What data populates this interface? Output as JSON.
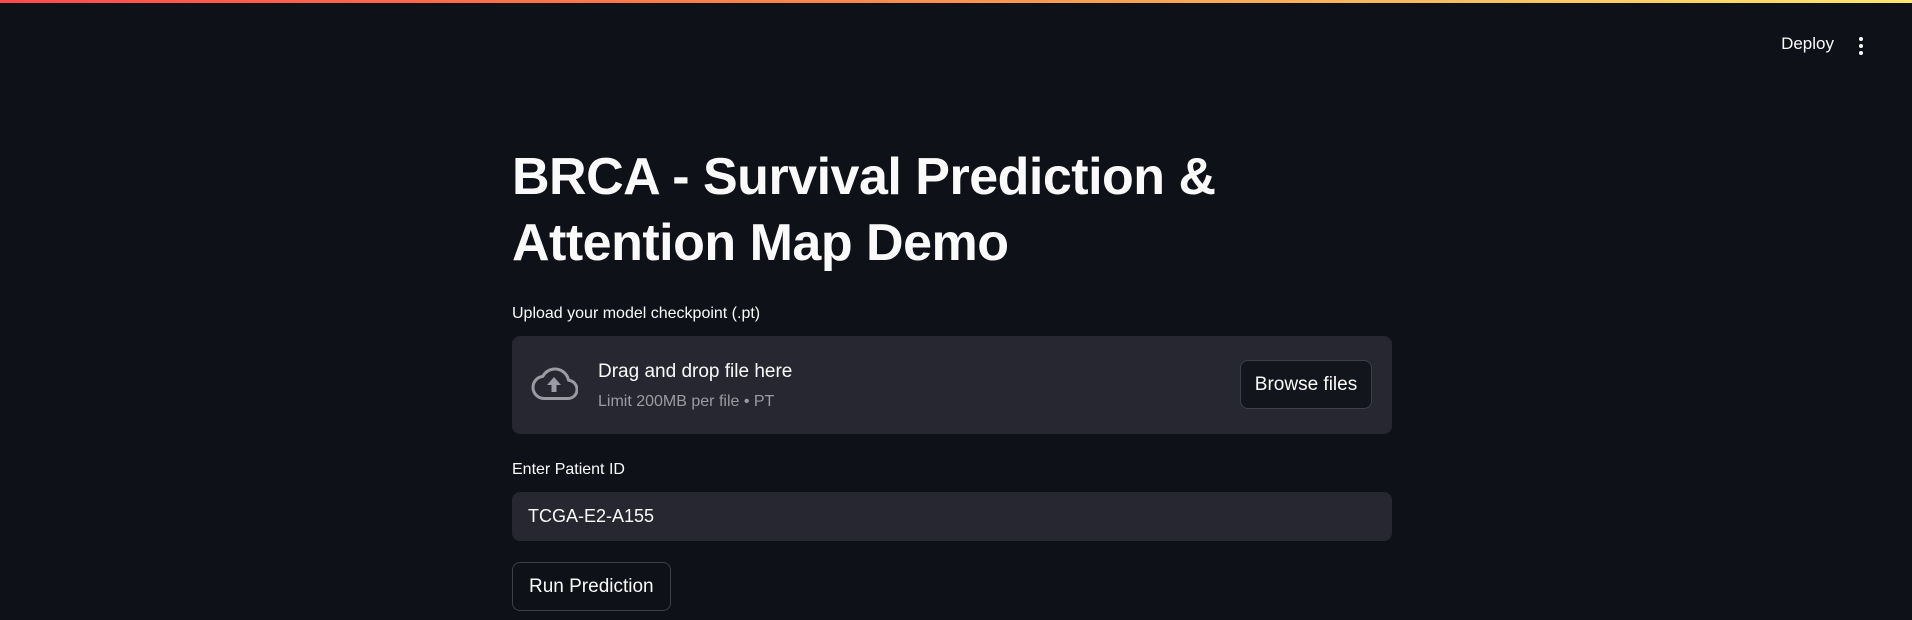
{
  "header": {
    "deploy_label": "Deploy",
    "menu_icon": "kebab-menu-icon"
  },
  "main": {
    "title": "BRCA - Survival Prediction & Attention Map Demo",
    "uploader": {
      "label": "Upload your model checkpoint (.pt)",
      "icon": "cloud-upload-icon",
      "drop_title": "Drag and drop file here",
      "drop_subtitle": "Limit 200MB per file • PT",
      "browse_label": "Browse files"
    },
    "patient": {
      "label": "Enter Patient ID",
      "value": "TCGA-E2-A155"
    },
    "run_label": "Run Prediction"
  },
  "colors": {
    "background": "#0e1117",
    "surface": "#262730",
    "text": "#fafafa",
    "muted": "#9a9ba3",
    "accent_gradient_start": "#ff4b4b",
    "accent_gradient_end": "#ffe66d"
  }
}
